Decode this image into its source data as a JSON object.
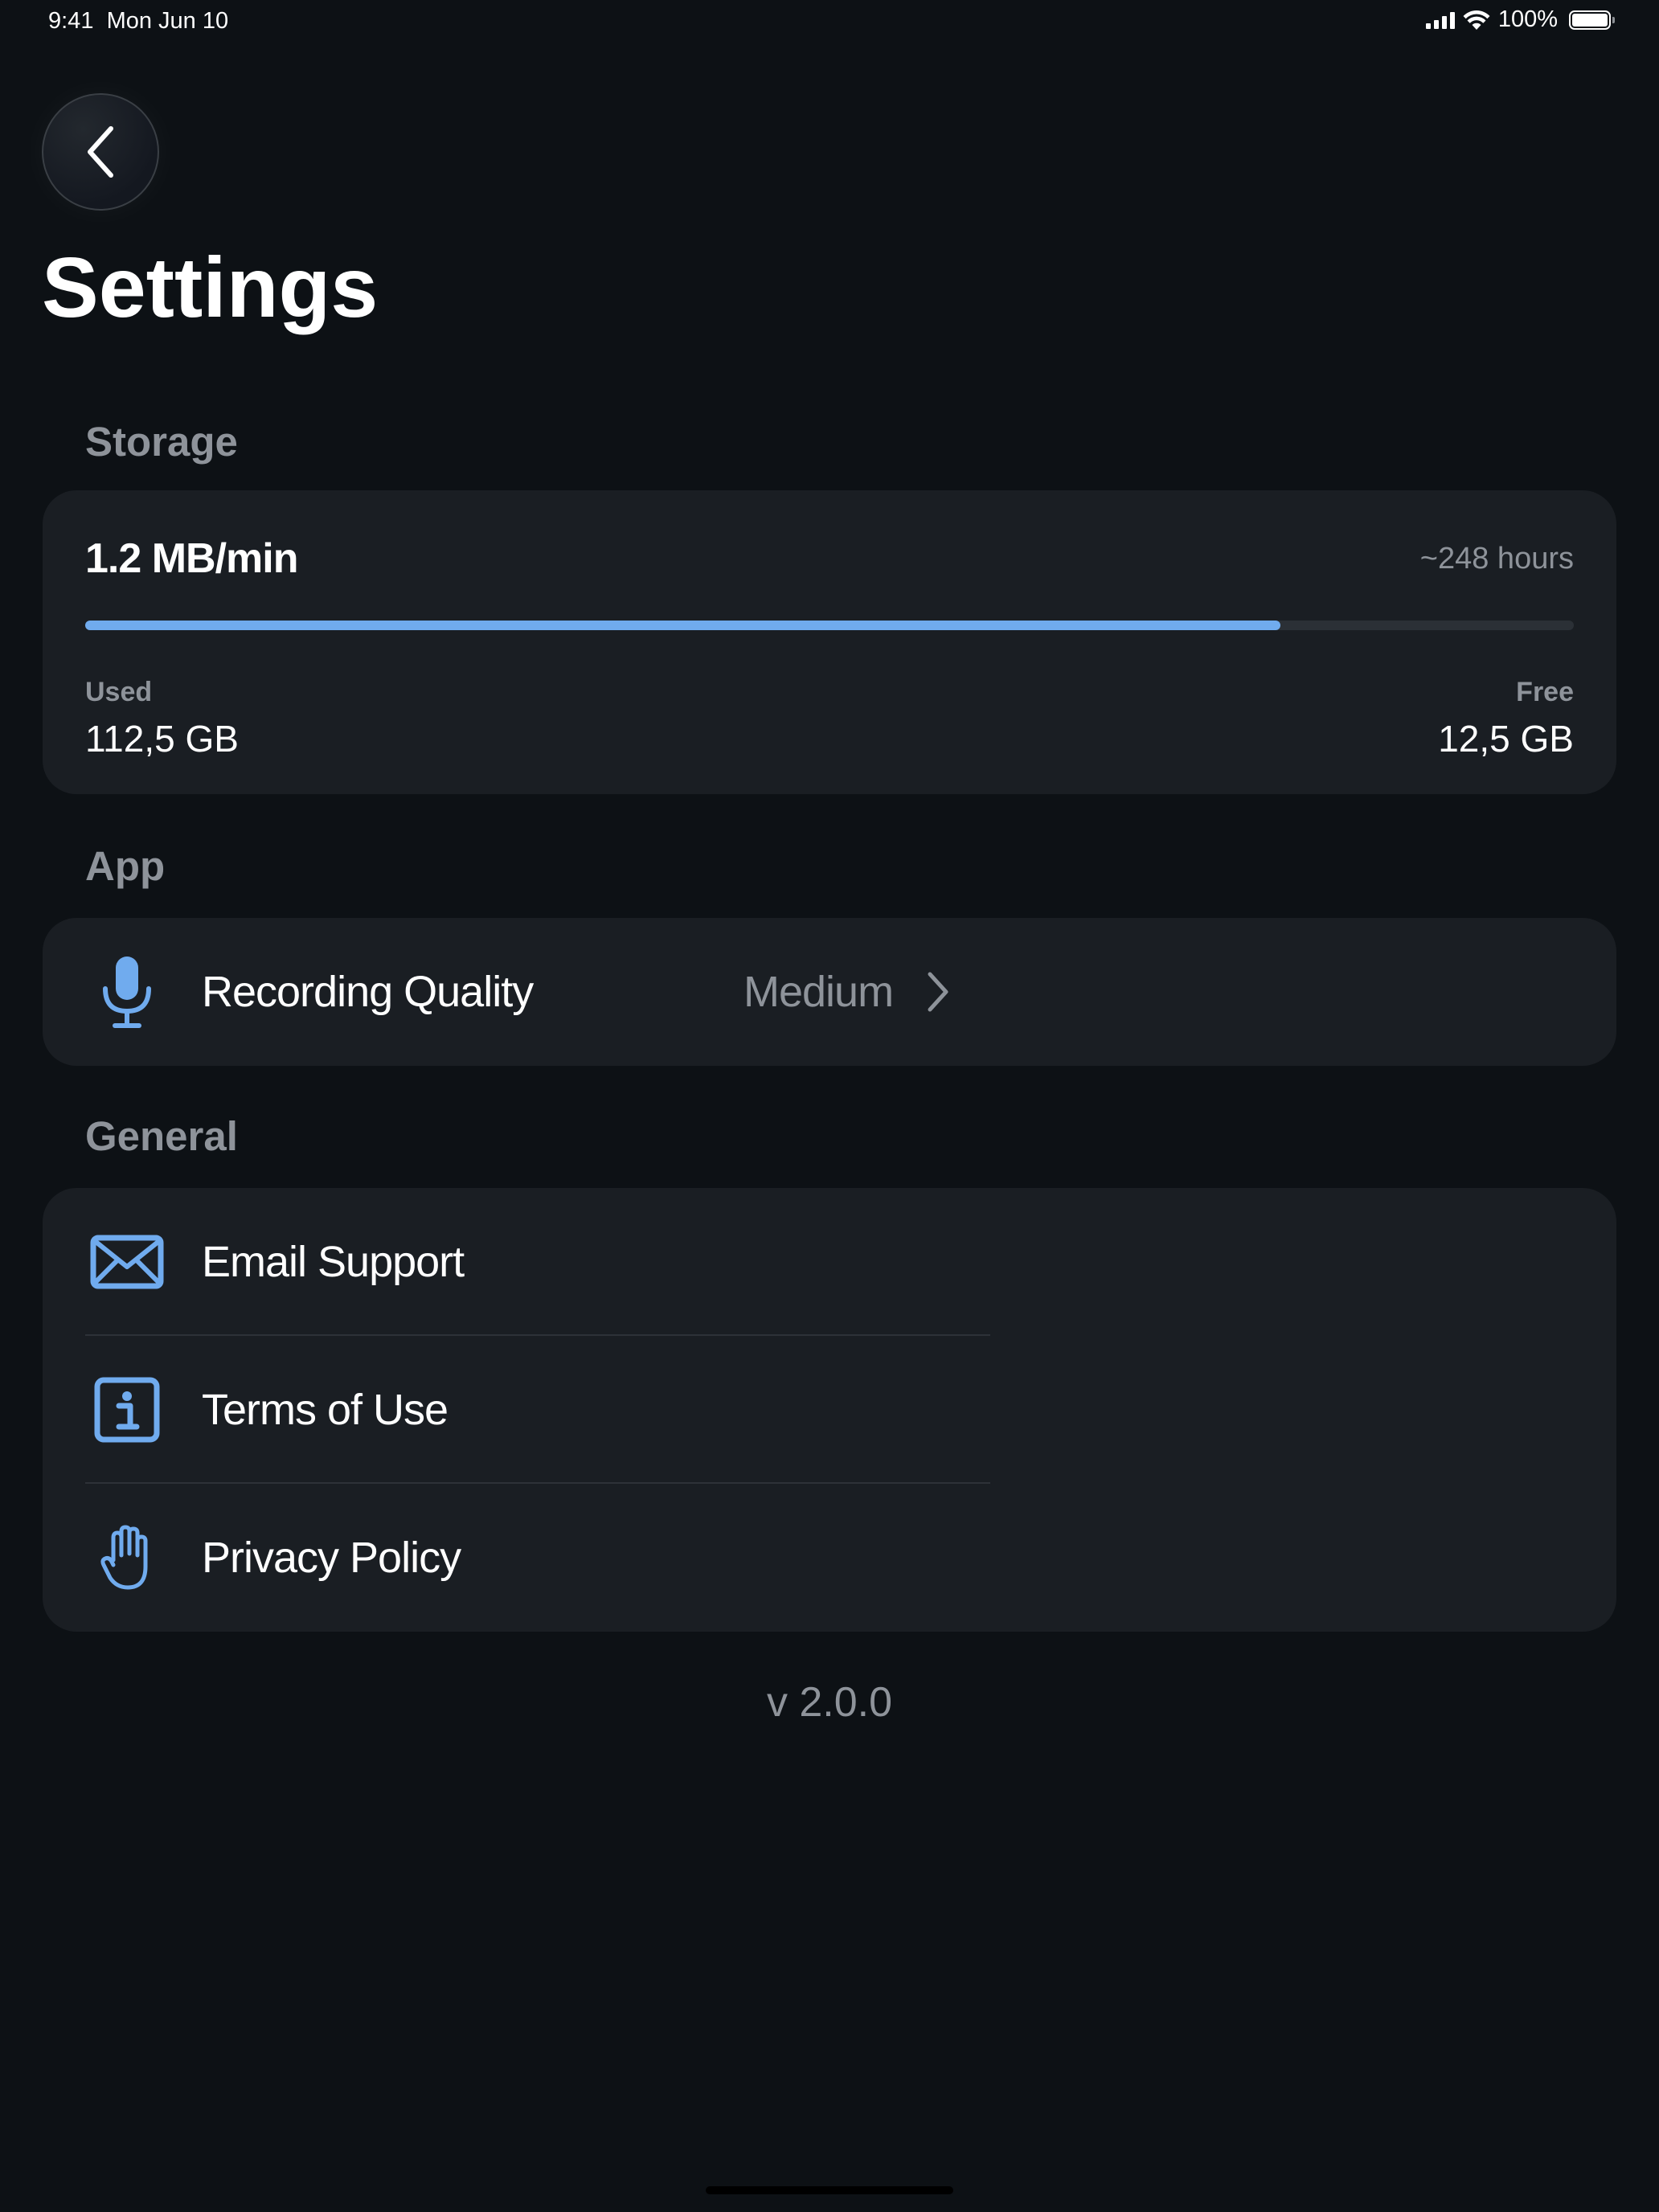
{
  "status_bar": {
    "time": "9:41",
    "date": "Mon Jun 10",
    "battery": "100%"
  },
  "page": {
    "title": "Settings"
  },
  "storage": {
    "section_label": "Storage",
    "rate": "1.2 MB/min",
    "remaining": "~248 hours",
    "used_fraction": 0.803,
    "used_label": "Used",
    "used_value": "112,5 GB",
    "free_label": "Free",
    "free_value": "12,5 GB",
    "bar_color": "#70abee"
  },
  "app": {
    "section_label": "App",
    "recording_quality": {
      "label": "Recording Quality",
      "value": "Medium",
      "icon": "microphone-icon"
    }
  },
  "general": {
    "section_label": "General",
    "items": [
      {
        "label": "Email Support",
        "icon": "envelope-icon"
      },
      {
        "label": "Terms of Use",
        "icon": "info-icon"
      },
      {
        "label": "Privacy Policy",
        "icon": "hand-icon"
      }
    ]
  },
  "footer": {
    "version": "v 2.0.0"
  },
  "colors": {
    "background": "#0d1115",
    "card": "#1a1e23",
    "accent": "#70abee",
    "muted_text": "#8e939a"
  }
}
